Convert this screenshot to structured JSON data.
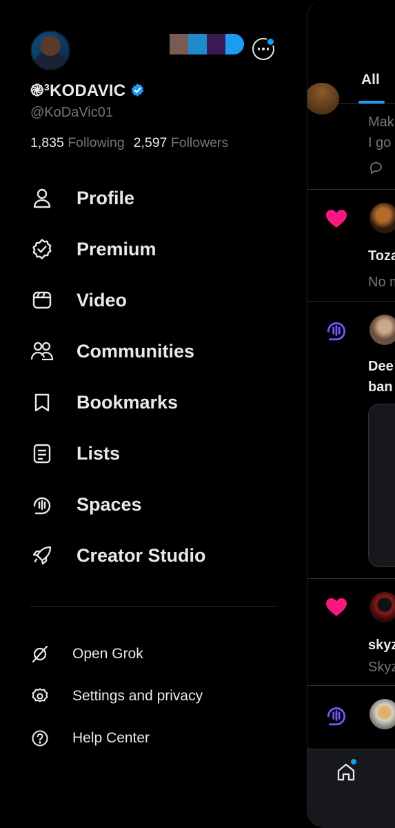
{
  "profile": {
    "display_name": "֎³KODAVIC",
    "handle": "@KoDaVic01",
    "following_count": "1,835",
    "following_label": "Following",
    "followers_count": "2,597",
    "followers_label": "Followers",
    "verified_color": "#1d9bf0"
  },
  "account_swatches": [
    "#7a5a52",
    "#1e8ac9",
    "#3a1a55",
    "#1d9bf0"
  ],
  "menu": [
    {
      "label": "Profile",
      "icon": "person-icon"
    },
    {
      "label": "Premium",
      "icon": "premium-badge-icon"
    },
    {
      "label": "Video",
      "icon": "video-icon"
    },
    {
      "label": "Communities",
      "icon": "communities-icon"
    },
    {
      "label": "Bookmarks",
      "icon": "bookmark-icon"
    },
    {
      "label": "Lists",
      "icon": "list-icon"
    },
    {
      "label": "Spaces",
      "icon": "spaces-icon"
    },
    {
      "label": "Creator Studio",
      "icon": "rocket-icon"
    }
  ],
  "secondary_menu": [
    {
      "label": "Open Grok",
      "icon": "grok-icon"
    },
    {
      "label": "Settings and privacy",
      "icon": "gear-icon"
    },
    {
      "label": "Help Center",
      "icon": "help-icon"
    }
  ],
  "feed": {
    "tab_label": "All",
    "snippets": {
      "s1a": "Mak",
      "s1b": "I go",
      "s2a": "Toza",
      "s2b": "No m",
      "s3a": "Dee",
      "s3b": "ban",
      "s4a": "skyz",
      "s4b": "Skyz"
    }
  },
  "colors": {
    "accent": "#1d9bf0",
    "like": "#f91880",
    "spaces": "#7856ff"
  }
}
